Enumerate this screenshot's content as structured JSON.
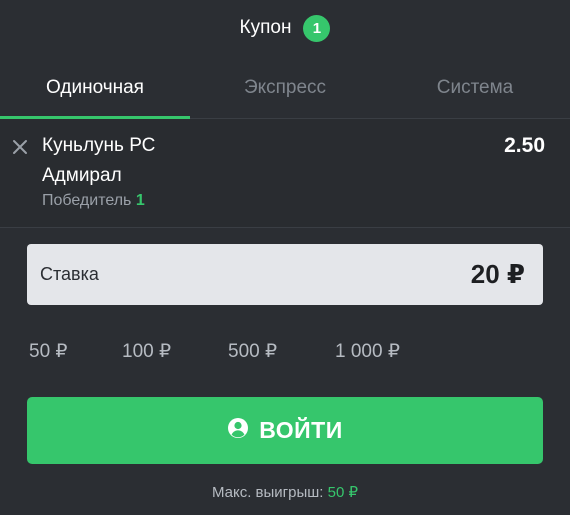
{
  "header": {
    "title": "Купон",
    "count": "1"
  },
  "tabs": [
    {
      "label": "Одиночная",
      "active": true
    },
    {
      "label": "Экспресс",
      "active": false
    },
    {
      "label": "Система",
      "active": false
    }
  ],
  "bet": {
    "team_line1": "Куньлунь РС",
    "team_line2": "Адмирал",
    "outcome_label": "Победитель",
    "outcome_value": "1",
    "odds": "2.50"
  },
  "stake": {
    "label": "Ставка",
    "value": "20 ₽"
  },
  "quick_amounts": [
    "50 ₽",
    "100 ₽",
    "500 ₽",
    "1 000 ₽"
  ],
  "login": {
    "label": "ВОЙТИ",
    "icon": "user-circle-icon"
  },
  "max_win": {
    "label": "Макс. выигрыш:",
    "value": "50 ₽"
  },
  "colors": {
    "accent": "#36c66c",
    "background": "#2b2e33",
    "input_bg": "#e4e6ea"
  }
}
